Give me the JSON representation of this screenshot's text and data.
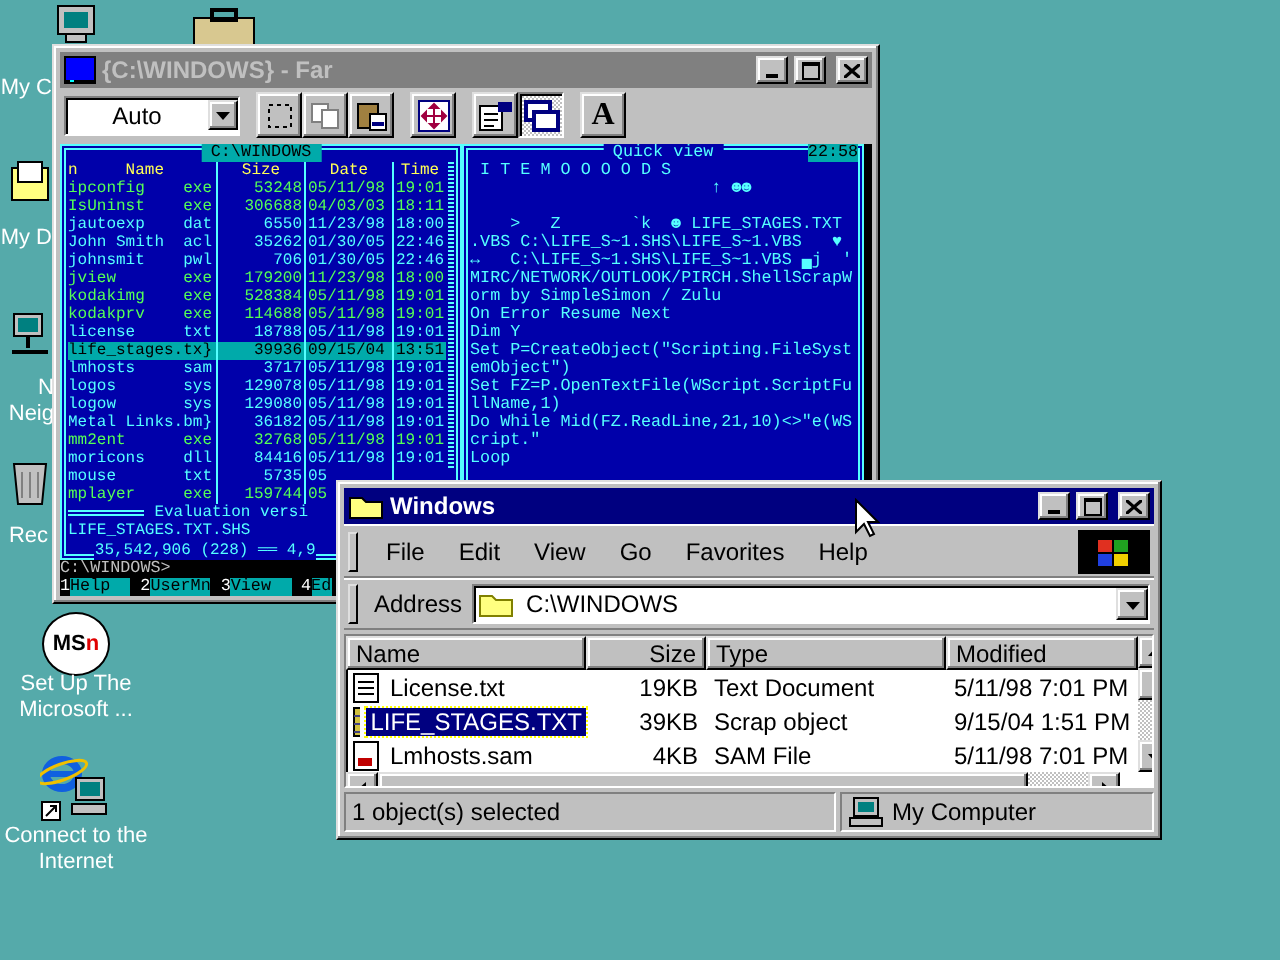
{
  "desktop_icons": [
    {
      "kind": "computer",
      "label": [
        "My C"
      ]
    },
    {
      "kind": "documents",
      "label": [
        "My D"
      ]
    },
    {
      "kind": "network",
      "label": [
        "N",
        "Neig"
      ]
    },
    {
      "kind": "recycle_bin",
      "label": [
        "Rec"
      ]
    },
    {
      "kind": "msn",
      "label": [
        "Set Up The",
        "Microsoft ..."
      ],
      "logo": [
        "MS",
        "n"
      ]
    },
    {
      "kind": "internet",
      "label": [
        "Connect to the",
        "Internet"
      ]
    }
  ],
  "far": {
    "title": "{C:\\WINDOWS} - Far",
    "active": false,
    "toolbar": {
      "font_size": "Auto",
      "buttons": [
        {
          "kind": "mark",
          "pressed": false
        },
        {
          "kind": "copy",
          "pressed": false
        },
        {
          "kind": "paste",
          "pressed": false
        },
        {
          "kind": "fullscreen",
          "pressed": false
        },
        {
          "kind": "properties",
          "pressed": false
        },
        {
          "kind": "background",
          "pressed": true
        },
        {
          "kind": "font",
          "pressed": false,
          "label": "A"
        }
      ]
    },
    "left_panel": {
      "path": "C:\\WINDOWS",
      "active": true,
      "columns": [
        "n",
        "Name",
        "Size",
        "Date",
        "Time"
      ],
      "rows": [
        {
          "name": "ipconfig",
          "ext": "exe",
          "size": "53248",
          "date": "05/11/98",
          "time": "19:01",
          "kind": "executable",
          "selected": false
        },
        {
          "name": "IsUninst",
          "ext": "exe",
          "size": "306688",
          "date": "04/03/03",
          "time": "18:11",
          "kind": "executable",
          "selected": false
        },
        {
          "name": "jautoexp",
          "ext": "dat",
          "size": "6550",
          "date": "11/23/98",
          "time": "18:00",
          "kind": "file",
          "selected": false
        },
        {
          "name": "John Smith",
          "ext": "acl",
          "size": "35262",
          "date": "01/30/05",
          "time": "22:46",
          "kind": "file",
          "selected": false
        },
        {
          "name": "johnsmit",
          "ext": "pwl",
          "size": "706",
          "date": "01/30/05",
          "time": "22:46",
          "kind": "file",
          "selected": false
        },
        {
          "name": "jview",
          "ext": "exe",
          "size": "179200",
          "date": "11/23/98",
          "time": "18:00",
          "kind": "executable",
          "selected": false
        },
        {
          "name": "kodakimg",
          "ext": "exe",
          "size": "528384",
          "date": "05/11/98",
          "time": "19:01",
          "kind": "executable",
          "selected": false
        },
        {
          "name": "kodakprv",
          "ext": "exe",
          "size": "114688",
          "date": "05/11/98",
          "time": "19:01",
          "kind": "executable",
          "selected": false
        },
        {
          "name": "license",
          "ext": "txt",
          "size": "18788",
          "date": "05/11/98",
          "time": "19:01",
          "kind": "file",
          "selected": false
        },
        {
          "name": "life_stages.tx}",
          "size": "39936",
          "date": "09/15/04",
          "time": "13:51",
          "kind": "file",
          "selected": true
        },
        {
          "name": "lmhosts",
          "ext": "sam",
          "size": "3717",
          "date": "05/11/98",
          "time": "19:01",
          "kind": "file",
          "selected": false
        },
        {
          "name": "logos",
          "ext": "sys",
          "size": "129078",
          "date": "05/11/98",
          "time": "19:01",
          "kind": "file",
          "selected": false
        },
        {
          "name": "logow",
          "ext": "sys",
          "size": "129080",
          "date": "05/11/98",
          "time": "19:01",
          "kind": "file",
          "selected": false
        },
        {
          "name": "Metal Links.bm}",
          "size": "36182",
          "date": "05/11/98",
          "time": "19:01",
          "kind": "file",
          "selected": false
        },
        {
          "name": "mm2ent",
          "ext": "exe",
          "size": "32768",
          "date": "05/11/98",
          "time": "19:01",
          "kind": "executable",
          "selected": false
        },
        {
          "name": "moricons",
          "ext": "dll",
          "size": "84416",
          "date": "05/11/98",
          "time": "19:01",
          "kind": "file",
          "selected": false
        },
        {
          "name": "mouse",
          "ext": "txt",
          "size": "5735",
          "date": "05",
          "kind": "file",
          "selected": false
        },
        {
          "name": "mplayer",
          "ext": "exe",
          "size": "159744",
          "date": "05",
          "kind": "executable",
          "selected": false
        }
      ],
      "notice": "Evaluation versi",
      "current_file": "LIFE_STAGES.TXT.SHS",
      "totals": "35,542,906 (228) ══ 4,9"
    },
    "quick_view": {
      "title": "Quick view",
      "active": false,
      "clock": "22:58",
      "header_lines": [
        " I T E M O O O O D S",
        "                        ↑ ☻☻"
      ],
      "body_lines": [
        "    >   Z       `k  ☻ LIFE_STAGES.TXT",
        ".VBS C:\\LIFE_S~1.SHS\\LIFE_S~1.VBS   ♥",
        "↔   C:\\LIFE_S~1.SHS\\LIFE_S~1.VBS ▄j  '",
        "MIRC/NETWORK/OUTLOOK/PIRCH.ShellScrapW",
        "orm by SimpleSimon / Zulu",
        "On Error Resume Next",
        "Dim Y",
        "Set P=CreateObject(\"Scripting.FileSyst",
        "emObject\")",
        "Set FZ=P.OpenTextFile(WScript.ScriptFu",
        "llName,1)",
        "Do While Mid(FZ.ReadLine,21,10)<>\"e(WS",
        "cript.\"",
        "Loop"
      ]
    },
    "command_line": "C:\\WINDOWS>",
    "key_bar": [
      {
        "key": "1",
        "label": "Help"
      },
      {
        "key": "2",
        "label": "UserMn"
      },
      {
        "key": "3",
        "label": "View"
      },
      {
        "key": "4",
        "label": "Ed"
      }
    ]
  },
  "explorer": {
    "title": "Windows",
    "active": true,
    "menu": [
      "File",
      "Edit",
      "View",
      "Go",
      "Favorites",
      "Help"
    ],
    "address_label": "Address",
    "address": "C:\\WINDOWS",
    "columns": [
      "Name",
      "Size",
      "Type",
      "Modified"
    ],
    "rows": [
      {
        "kind": "text",
        "name": "License.txt",
        "size": "19KB",
        "type": "Text Document",
        "modified": "5/11/98 7:01 PM",
        "selected": false
      },
      {
        "kind": "scrap",
        "name": "LIFE_STAGES.TXT",
        "size": "39KB",
        "type": "Scrap object",
        "modified": "9/15/04 1:51 PM",
        "selected": true
      },
      {
        "kind": "sam",
        "name": "Lmhosts.sam",
        "size": "4KB",
        "type": "SAM File",
        "modified": "5/11/98 7:01 PM",
        "selected": false
      }
    ],
    "status": "1 object(s) selected",
    "zone": "My Computer"
  }
}
